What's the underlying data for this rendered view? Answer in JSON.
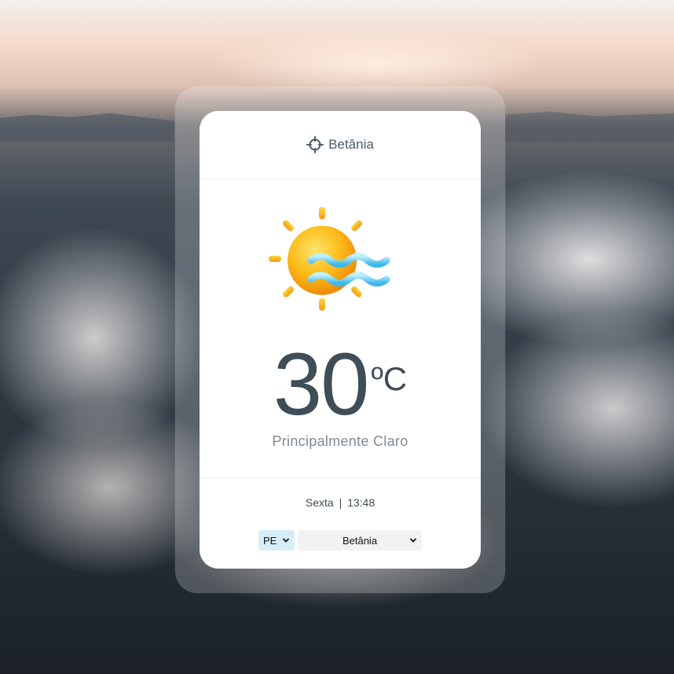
{
  "location": {
    "name": "Betânia",
    "icon": "crosshair-icon"
  },
  "weather": {
    "icon": "sun-with-wind-icon",
    "temperature": "30",
    "unit": "ºC",
    "description": "Principalmente Claro"
  },
  "datetime": {
    "day": "Sexta",
    "separator": "|",
    "time": "13:48"
  },
  "selects": {
    "state": {
      "value": "PE"
    },
    "city": {
      "value": "Betânia"
    }
  },
  "colors": {
    "text_primary": "#3f4d57",
    "text_secondary": "#808a92",
    "state_select_bg": "#d7eef9",
    "city_select_bg": "#f2f2f2",
    "sun": "#f7a90f",
    "wind": "#55c8ec"
  }
}
